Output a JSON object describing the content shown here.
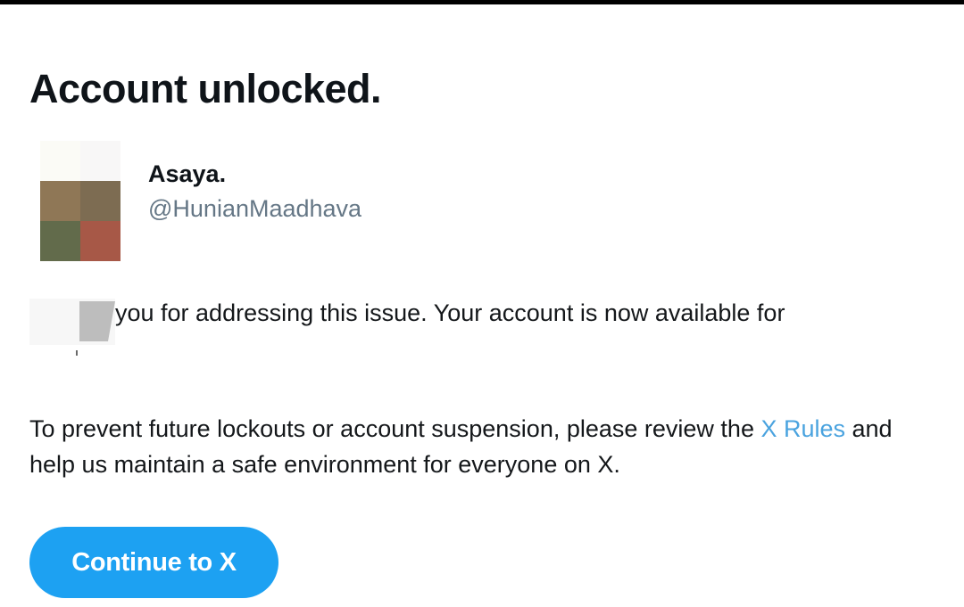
{
  "page": {
    "title": "Account unlocked."
  },
  "user": {
    "display_name": "Asaya.",
    "handle": "@HunianMaadhava",
    "avatar_colors": [
      "#fbfbf6",
      "#f8f7f7",
      "#8f7756",
      "#7d6c52",
      "#626b4b",
      "#a75847"
    ]
  },
  "message": {
    "thanks_visible": "you for addressing this issue. Your account is now available for",
    "policy_before": "To prevent future lockouts or account suspension, please review the ",
    "rules_link": "X Rules",
    "policy_after": " and help us maintain a safe environment for everyone on X."
  },
  "actions": {
    "continue_label": "Continue to X"
  },
  "colors": {
    "accent": "#1da1f2",
    "link": "#4aa3df",
    "handle": "#657786",
    "top_bar": "#000000"
  }
}
